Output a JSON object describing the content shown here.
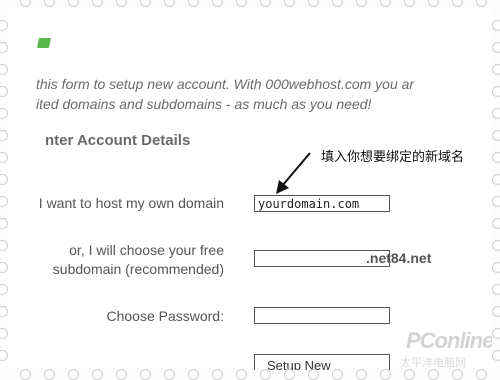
{
  "intro": {
    "line1": "this form to setup new account. With 000webhost.com you ar",
    "line2": "ited domains and subdomains - as much as you need!"
  },
  "section_title": "nter Account Details",
  "annotation": "填入你想要绑定的新域名",
  "form": {
    "own_domain_label": "I want to host my own domain",
    "own_domain_value": "yourdomain.com",
    "subdomain_label_1": "or, I will choose your free",
    "subdomain_label_2": "subdomain (recommended)",
    "subdomain_value": "",
    "subdomain_suffix": ".net84.net",
    "password_label": "Choose Password:",
    "password_value": "",
    "setup_button": "Setup New"
  },
  "watermark": {
    "brand": "PConline",
    "sub": "太平洋电脑网"
  }
}
